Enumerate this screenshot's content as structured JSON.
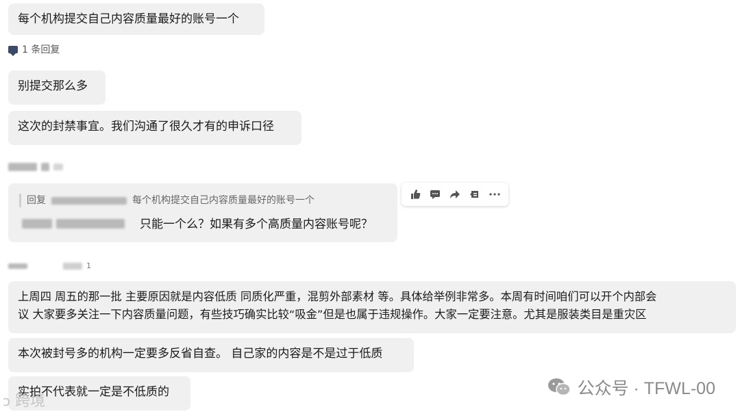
{
  "messages": {
    "m1": "每个机构提交自己内容质量最好的账号一个",
    "reply_count": "1 条回复",
    "m2": "别提交那么多",
    "m3": "这次的封禁事宜。我们沟通了很久才有的申诉口径",
    "quote_prefix": "回复",
    "quote_text": "每个机构提交自己内容质量最好的账号一个",
    "m4": "只能一个么？如果有多个高质量内容账号呢？",
    "m5_line1": "上周四 周五的那一批 主要原因就是内容低质 同质化严重，混剪外部素材 等。具体给举例非常多。本周有时间咱们可以开个内部会",
    "m5_line2": "议 大家要多关注一下内容质量问题，有些技巧确实比较“吸金”但是也属于违规操作。大家一定要注意。尤其是服装类目是重灾区",
    "m6": "本次被封号多的机构一定要多反省自查。 自己家的内容是不是过于低质",
    "m7": "实拍不代表就一定是不低质的",
    "small_count": "1"
  },
  "watermark": "公众号 · TFWL-00",
  "bottom_logo": "跨境",
  "toolbar": [
    "thumbs-up-icon",
    "comment-icon",
    "forward-icon",
    "bookmark-icon",
    "more-icon"
  ]
}
